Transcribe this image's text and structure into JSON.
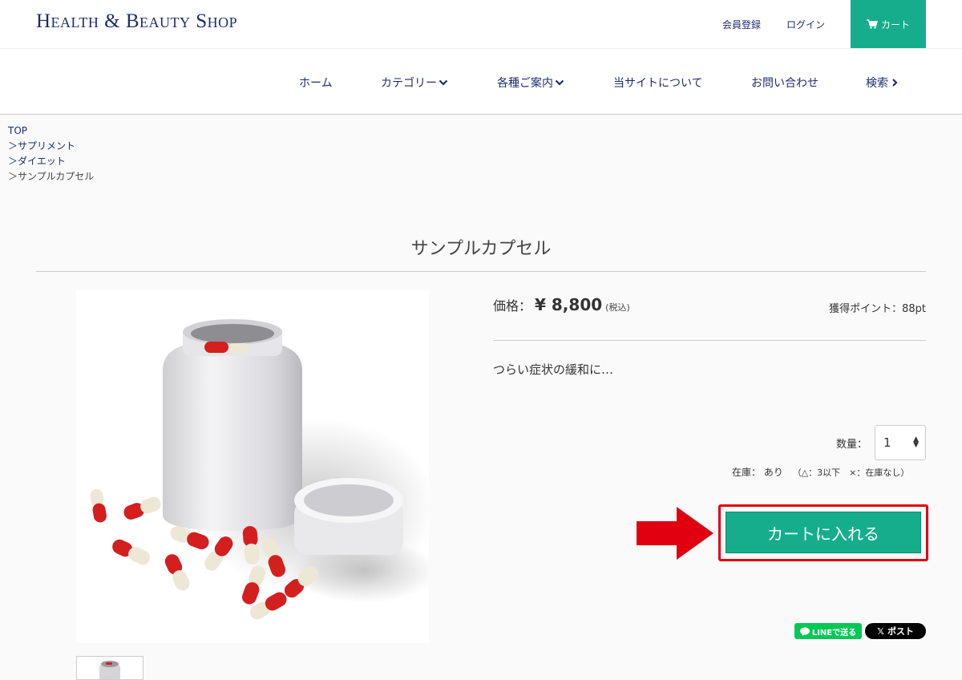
{
  "header": {
    "logo": "Health & Beauty Shop",
    "register_label": "会員登録",
    "login_label": "ログイン",
    "cart_label": "カート",
    "accent_color": "#16ad8c"
  },
  "nav": {
    "items": [
      {
        "label": "ホーム",
        "icon": ""
      },
      {
        "label": "カテゴリー",
        "icon": "chevron-down-icon"
      },
      {
        "label": "各種ご案内",
        "icon": "chevron-down-icon"
      },
      {
        "label": "当サイトについて",
        "icon": ""
      },
      {
        "label": "お問い合わせ",
        "icon": ""
      },
      {
        "label": "検索",
        "icon": "chevron-right-icon"
      }
    ]
  },
  "breadcrumb": [
    "TOP",
    "＞サプリメント",
    "＞ダイエット",
    "＞サンプルカプセル"
  ],
  "product": {
    "title": "サンプルカプセル",
    "price_label": "価格：",
    "price_value": "¥ 8,800",
    "price_tax": "(税込)",
    "points": "獲得ポイント：88pt",
    "description": "つらい症状の緩和に…",
    "quantity_label": "数量：",
    "quantity_value": "1",
    "stock_label": "在庫：",
    "stock_value": "あり",
    "stock_legend": "（△：3以下　×：在庫なし）",
    "add_to_cart_label": "カートに入れる"
  },
  "share": {
    "line_label": "LINEで送る",
    "x_label": "ポスト"
  },
  "annotation_color": "#e10010"
}
